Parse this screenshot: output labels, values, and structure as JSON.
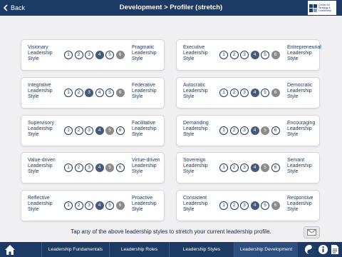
{
  "header": {
    "back_label": "Back",
    "title": "Development > Profiler (stretch)",
    "logo_text": "Center for Strategy & Leadership"
  },
  "scale_numbers": [
    "1",
    "2",
    "3",
    "4",
    "5",
    "6"
  ],
  "profiles": [
    {
      "left": "Visionary Leadership Style",
      "right": "Pragmatic Leadership Style",
      "current": 4,
      "stretch": 6
    },
    {
      "left": "Executive Leadership Style",
      "right": "Entrepreneurial Leadership Style",
      "current": 4,
      "stretch": 6
    },
    {
      "left": "Integrative Leadership Style",
      "right": "Federative Leadership Style",
      "current": 3,
      "stretch": 6
    },
    {
      "left": "Autocratic Leadership Style",
      "right": "Democratic Leadership Style",
      "current": 4,
      "stretch": 6
    },
    {
      "left": "Supervisory Leadership Style",
      "right": "Facilitative Leadership Style",
      "current": 4,
      "stretch": 5
    },
    {
      "left": "Demanding Leadership Style",
      "right": "Encouraging Leadership Style",
      "current": 4,
      "stretch": 5
    },
    {
      "left": "Value-driven Leadership Style",
      "right": "Virtue-driven Leadership Style",
      "current": 4,
      "stretch": 5
    },
    {
      "left": "Sovereign Leadership Style",
      "right": "Servant Leadership Style",
      "current": 4,
      "stretch": 5
    },
    {
      "left": "Reflective Leadership Style",
      "right": "Proactive Leadership Style",
      "current": 4,
      "stretch": 6
    },
    {
      "left": "Consistent Leadership Style",
      "right": "Responsive Leadership Style",
      "current": 4,
      "stretch": 6
    }
  ],
  "hint": "Tap any of the above leadership styles to stretch your current leadership profile.",
  "tabs": [
    "Leadership Fundamentals",
    "Leadership Roles",
    "Leadership Styles",
    "Leadership Development"
  ],
  "active_tab": "Leadership Development",
  "icons": {
    "back": "chevron-left-icon",
    "mail": "mail-icon",
    "home": "home-icon",
    "a": "yin-yang-icon",
    "b": "info-icon",
    "c": "document-icon"
  },
  "colors": {
    "navy": "#1c3a63",
    "current": "#45597a",
    "stretch": "#8a8a8a"
  }
}
